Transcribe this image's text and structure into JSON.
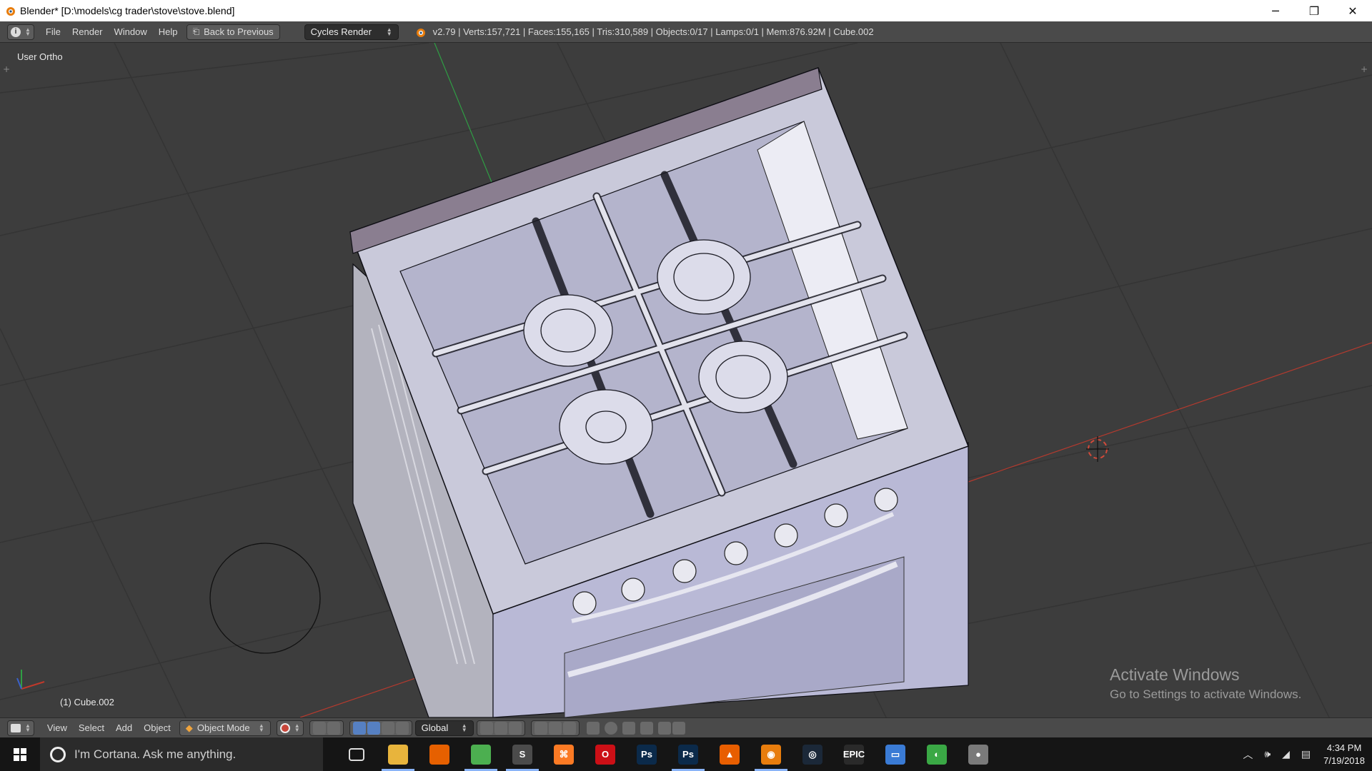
{
  "window": {
    "title": "Blender* [D:\\models\\cg trader\\stove\\stove.blend]",
    "minimize": "─",
    "restore": "❐",
    "close": "✕"
  },
  "infobar": {
    "menus": [
      "File",
      "Render",
      "Window",
      "Help"
    ],
    "back_button": "Back to Previous",
    "render_engine": "Cycles Render",
    "stats": "v2.79 | Verts:157,721 | Faces:155,165 | Tris:310,589 | Objects:0/17 | Lamps:0/1 | Mem:876.92M | Cube.002"
  },
  "viewport": {
    "view_name": "User Ortho",
    "active_object": "(1) Cube.002",
    "watermark_title": "Activate Windows",
    "watermark_text": "Go to Settings to activate Windows."
  },
  "bottombar": {
    "menus": [
      "View",
      "Select",
      "Add",
      "Object"
    ],
    "mode": "Object Mode",
    "orientation": "Global"
  },
  "taskbar": {
    "search_placeholder": "I'm Cortana. Ask me anything.",
    "apps": [
      {
        "name": "task-view-icon",
        "label": "",
        "color": "#151515",
        "active": false
      },
      {
        "name": "file-explorer-icon",
        "label": "",
        "color": "#e8b43c",
        "active": true
      },
      {
        "name": "firefox-icon",
        "label": "",
        "color": "#e66000",
        "active": false
      },
      {
        "name": "chrome-icon",
        "label": "",
        "color": "#4caf50",
        "active": true
      },
      {
        "name": "sublime-icon",
        "label": "S",
        "color": "#4b4b4b",
        "active": true
      },
      {
        "name": "xampp-icon",
        "label": "⌘",
        "color": "#fb7a24",
        "active": false
      },
      {
        "name": "opera-icon",
        "label": "O",
        "color": "#cc0f16",
        "active": false
      },
      {
        "name": "photoshop-icon",
        "label": "Ps",
        "color": "#0b2a4a",
        "active": false
      },
      {
        "name": "photoshop-2-icon",
        "label": "Ps",
        "color": "#0b2a4a",
        "active": true
      },
      {
        "name": "vlc-icon",
        "label": "▲",
        "color": "#e85e00",
        "active": false
      },
      {
        "name": "blender-icon",
        "label": "◉",
        "color": "#e87d0d",
        "active": true
      },
      {
        "name": "steam-icon",
        "label": "◎",
        "color": "#1b2838",
        "active": false
      },
      {
        "name": "epic-games-icon",
        "label": "EPIC",
        "color": "#2a2a2a",
        "active": false
      },
      {
        "name": "photos-icon",
        "label": "▭",
        "color": "#3a7bd5",
        "active": false
      },
      {
        "name": "network-app-icon",
        "label": "◐",
        "color": "#3aa845",
        "active": false
      },
      {
        "name": "installer-icon",
        "label": "●",
        "color": "#7a7a7a",
        "active": false
      }
    ],
    "time": "4:34 PM",
    "date": "7/19/2018"
  },
  "colors": {
    "viewport_bg": "#3d3d3d",
    "header_bg": "#4a4a4a",
    "grid_line": "#333333",
    "x_axis": "#c0392b",
    "y_axis": "#2f9e44",
    "model_face": "#c9c9da",
    "model_edge": "#0e0e14"
  }
}
